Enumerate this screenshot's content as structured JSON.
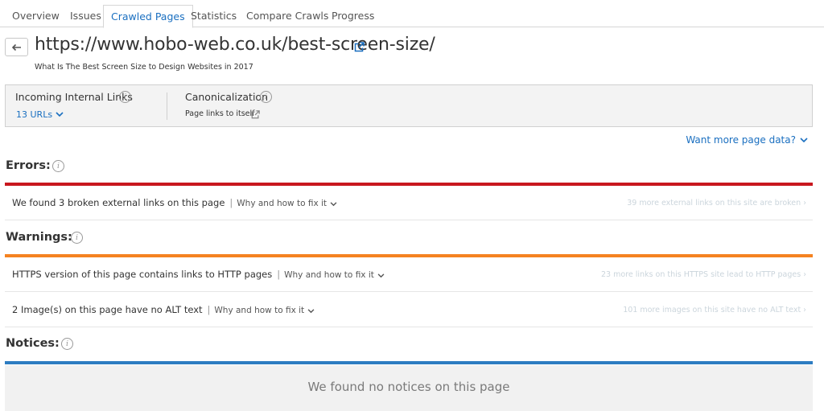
{
  "tabs": [
    "Overview",
    "Issues",
    "Crawled Pages",
    "Statistics",
    "Compare Crawls",
    "Progress"
  ],
  "active_tab": "Crawled Pages",
  "page": {
    "url": "https://www.hobo-web.co.uk/best-screen-size/",
    "subtitle": "What Is The Best Screen Size to Design Websites in 2017"
  },
  "info": {
    "incoming_label": "Incoming Internal Links",
    "incoming_value": "13 URLs",
    "canonical_label": "Canonicalization",
    "canonical_value": "Page links to itself"
  },
  "more_data": "Want more page data?",
  "colors": {
    "errors": "#c8171e",
    "warnings": "#f58220",
    "notices": "#2d7cc1",
    "link": "#1a6fc0"
  },
  "errors": {
    "title": "Errors:",
    "items": [
      {
        "text": "We found 3 broken external links on this page",
        "fix": "Why and how to fix it",
        "note": "39 more external links on this site are broken ›"
      }
    ]
  },
  "warnings": {
    "title": "Warnings:",
    "items": [
      {
        "text": "HTTPS version of this page contains links to HTTP pages",
        "fix": "Why and how to fix it",
        "note": "23 more links on this HTTPS site lead to HTTP pages ›"
      },
      {
        "text": "2 Image(s) on this page have no ALT text",
        "fix": "Why and how to fix it",
        "note": "101 more images on this site have no ALT text ›"
      }
    ]
  },
  "notices": {
    "title": "Notices:",
    "empty": "We found no notices on this page"
  }
}
